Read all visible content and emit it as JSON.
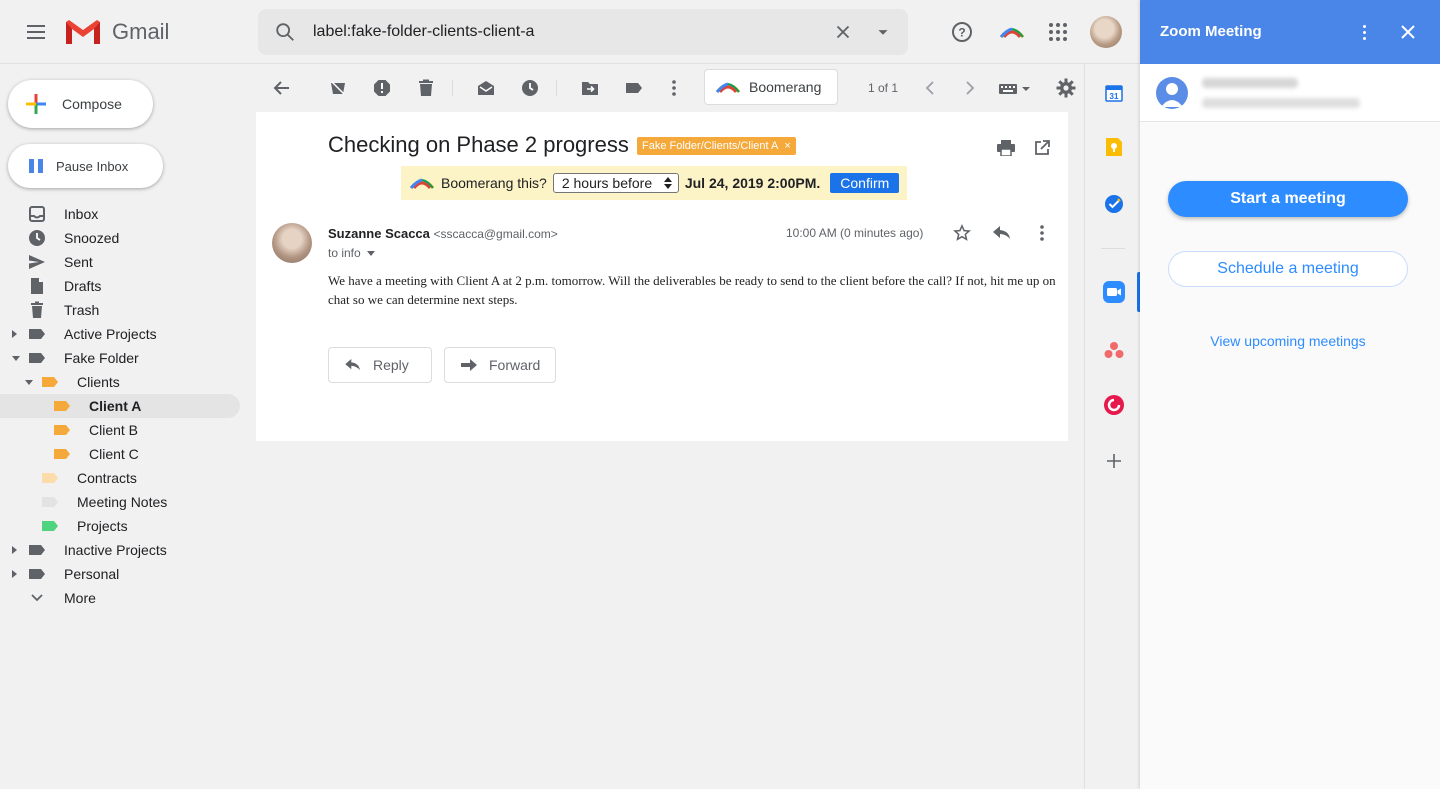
{
  "app": {
    "name": "Gmail"
  },
  "search": {
    "query": "label:fake-folder-clients-client-a"
  },
  "sidebar": {
    "compose_label": "Compose",
    "pause_label": "Pause Inbox",
    "items": [
      {
        "label": "Inbox"
      },
      {
        "label": "Snoozed"
      },
      {
        "label": "Sent"
      },
      {
        "label": "Drafts"
      },
      {
        "label": "Trash"
      },
      {
        "label": "Active Projects"
      },
      {
        "label": "Fake Folder"
      },
      {
        "label": "Clients"
      },
      {
        "label": "Client A"
      },
      {
        "label": "Client B"
      },
      {
        "label": "Client C"
      },
      {
        "label": "Contracts"
      },
      {
        "label": "Meeting Notes"
      },
      {
        "label": "Projects"
      },
      {
        "label": "Inactive Projects"
      },
      {
        "label": "Personal"
      },
      {
        "label": "More"
      }
    ]
  },
  "toolbar": {
    "boomerang_label": "Boomerang",
    "pager": "1 of 1"
  },
  "email": {
    "subject": "Checking on Phase 2 progress",
    "label_chip": "Fake Folder/Clients/Client A",
    "label_remove": "×",
    "boomerang": {
      "question": "Boomerang this?",
      "select_value": "2 hours before",
      "date": "Jul 24, 2019 2:00PM.",
      "confirm": "Confirm"
    },
    "sender_name": "Suzanne Scacca",
    "sender_email": "<sscacca@gmail.com>",
    "to": "to info",
    "time": "10:00 AM (0 minutes ago)",
    "body": "We have a meeting with Client A at 2 p.m. tomorrow. Will the deliverables be ready to send to the client before the call? If not, hit me up on chat so we can determine next steps.",
    "reply_label": "Reply",
    "forward_label": "Forward"
  },
  "zoom": {
    "title": "Zoom Meeting",
    "start": "Start a meeting",
    "schedule": "Schedule a meeting",
    "upcoming": "View upcoming meetings"
  },
  "colors": {
    "gmail_red": "#ea4335",
    "label_orange": "#f6a93b",
    "zoom_header": "#4a86e8",
    "zoom_blue": "#2d8cff",
    "boomerang_bar": "#fcf4c7",
    "confirm_blue": "#1a73e8"
  }
}
